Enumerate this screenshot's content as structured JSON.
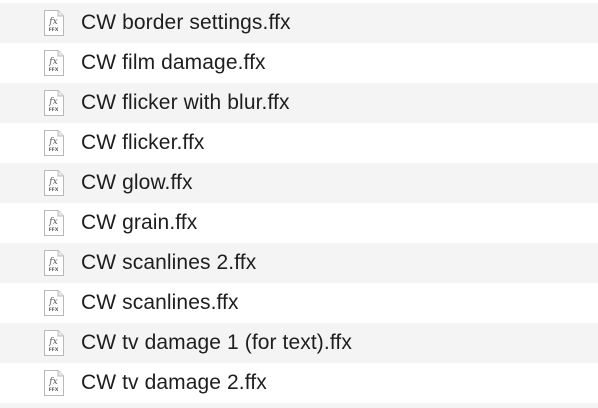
{
  "file_list": {
    "items": [
      {
        "name": "CW border settings.ffx",
        "icon": "ffx-file-icon",
        "icon_text_top": "fx",
        "icon_text_bottom": "FFX"
      },
      {
        "name": "CW film damage.ffx",
        "icon": "ffx-file-icon",
        "icon_text_top": "fx",
        "icon_text_bottom": "FFX"
      },
      {
        "name": "CW flicker with blur.ffx",
        "icon": "ffx-file-icon",
        "icon_text_top": "fx",
        "icon_text_bottom": "FFX"
      },
      {
        "name": "CW flicker.ffx",
        "icon": "ffx-file-icon",
        "icon_text_top": "fx",
        "icon_text_bottom": "FFX"
      },
      {
        "name": "CW glow.ffx",
        "icon": "ffx-file-icon",
        "icon_text_top": "fx",
        "icon_text_bottom": "FFX"
      },
      {
        "name": "CW grain.ffx",
        "icon": "ffx-file-icon",
        "icon_text_top": "fx",
        "icon_text_bottom": "FFX"
      },
      {
        "name": "CW scanlines 2.ffx",
        "icon": "ffx-file-icon",
        "icon_text_top": "fx",
        "icon_text_bottom": "FFX"
      },
      {
        "name": "CW scanlines.ffx",
        "icon": "ffx-file-icon",
        "icon_text_top": "fx",
        "icon_text_bottom": "FFX"
      },
      {
        "name": "CW tv damage 1 (for text).ffx",
        "icon": "ffx-file-icon",
        "icon_text_top": "fx",
        "icon_text_bottom": "FFX"
      },
      {
        "name": "CW tv damage 2.ffx",
        "icon": "ffx-file-icon",
        "icon_text_top": "fx",
        "icon_text_bottom": "FFX"
      }
    ]
  },
  "colors": {
    "row_alt_background": "#f4f4f4",
    "row_background": "#ffffff",
    "text": "#1e1e1e"
  }
}
